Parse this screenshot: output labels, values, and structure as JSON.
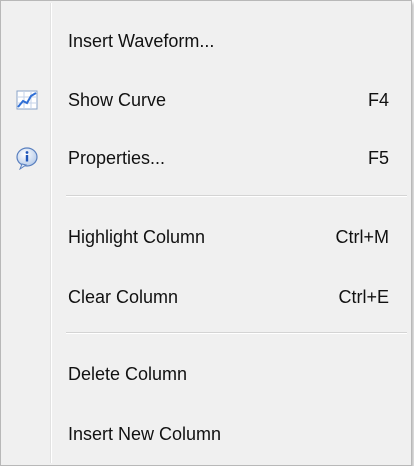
{
  "menu": {
    "items": [
      {
        "label": "Insert Waveform...",
        "shortcut": "",
        "icon": ""
      },
      {
        "label": "Show Curve",
        "shortcut": "F4",
        "icon": "chart-curve-icon"
      },
      {
        "label": "Properties...",
        "shortcut": "F5",
        "icon": "info-icon"
      },
      {
        "label": "Highlight Column",
        "shortcut": "Ctrl+M",
        "icon": ""
      },
      {
        "label": "Clear Column",
        "shortcut": "Ctrl+E",
        "icon": ""
      },
      {
        "label": "Delete Column",
        "shortcut": "",
        "icon": ""
      },
      {
        "label": "Insert New Column",
        "shortcut": "",
        "icon": ""
      }
    ]
  },
  "colors": {
    "menu_background": "#f0f0f0",
    "text": "#111111",
    "icon_blue": "#2f6fd6",
    "separator": "#d4d4d4"
  }
}
